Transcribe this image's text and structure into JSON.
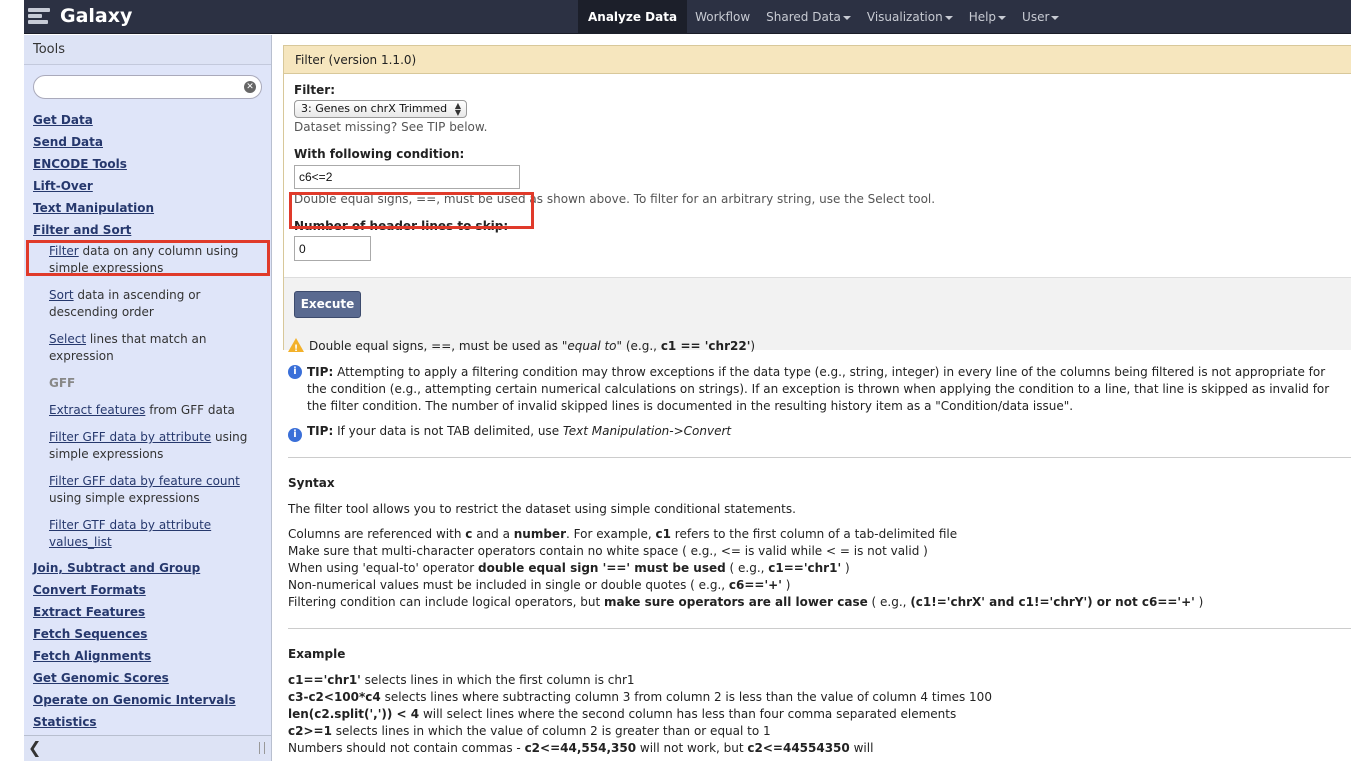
{
  "masthead": {
    "brand": "Galaxy",
    "nav": [
      {
        "label": "Analyze Data",
        "active": true,
        "dropdown": false
      },
      {
        "label": "Workflow",
        "active": false,
        "dropdown": false
      },
      {
        "label": "Shared Data",
        "active": false,
        "dropdown": true
      },
      {
        "label": "Visualization",
        "active": false,
        "dropdown": true
      },
      {
        "label": "Help",
        "active": false,
        "dropdown": true
      },
      {
        "label": "User",
        "active": false,
        "dropdown": true
      }
    ]
  },
  "tools": {
    "header": "Tools",
    "search_value": "",
    "sections_top": [
      "Get Data",
      "Send Data",
      "ENCODE Tools",
      "Lift-Over",
      "Text Manipulation",
      "Filter and Sort"
    ],
    "filter_tool": {
      "link": "Filter",
      "rest": " data on any column using simple expressions"
    },
    "sort_tool": {
      "link": "Sort",
      "rest": " data in ascending or descending order"
    },
    "select_tool": {
      "link": "Select",
      "rest": " lines that match an expression"
    },
    "gff_label": "GFF",
    "extract_tool": {
      "link": "Extract features",
      "rest": " from GFF data"
    },
    "gff_attr_tool": {
      "link": "Filter GFF data by attribute",
      "rest": " using simple expressions"
    },
    "gff_count_tool": {
      "link": "Filter GFF data by feature count",
      "rest": " using simple expressions"
    },
    "gtf_tool": {
      "link": "Filter GTF data by attribute values_list",
      "rest": ""
    },
    "sections_bottom": [
      "Join, Subtract and Group",
      "Convert Formats",
      "Extract Features",
      "Fetch Sequences",
      "Fetch Alignments",
      "Get Genomic Scores",
      "Operate on Genomic Intervals",
      "Statistics"
    ]
  },
  "form": {
    "title": "Filter (version 1.1.0)",
    "filter_label": "Filter:",
    "filter_value": "3: Genes on chrX Trimmed",
    "filter_help": "Dataset missing? See TIP below.",
    "condition_label": "With following condition:",
    "condition_value": "c6<=2",
    "condition_help": "Double equal signs, ==, must be used as shown above. To filter for an arbitrary string, use the Select tool.",
    "header_label": "Number of header lines to skip:",
    "header_value": "0",
    "execute_label": "Execute"
  },
  "help": {
    "warning_pre": "Double equal signs, ==, must be used as ",
    "warning_em": "\"equal to\"",
    "warning_mid": " (e.g., ",
    "warning_code": "c1 == 'chr22'",
    "warning_post": ")",
    "tip1_label": "TIP:",
    "tip1_text": " Attempting to apply a filtering condition may throw exceptions if the data type (e.g., string, integer) in every line of the columns being filtered is not appropriate for the condition (e.g., attempting certain numerical calculations on strings). If an exception is thrown when applying the condition to a line, that line is skipped as invalid for the filter condition. The number of invalid skipped lines is documented in the resulting history item as a \"Condition/data issue\".",
    "tip2_label": "TIP:",
    "tip2_text": " If your data is not TAB delimited, use ",
    "tip2_em": "Text Manipulation->Convert",
    "syntax_title": "Syntax",
    "syntax_intro": "The filter tool allows you to restrict the dataset using simple conditional statements.",
    "syntax_lines": [
      "Columns are referenced with <b>c</b> and a <b>number</b>. For example, <b>c1</b> refers to the first column of a tab-delimited file",
      "Make sure that multi-character operators contain no white space ( e.g., &lt;= is valid while &lt; = is not valid )",
      "When using 'equal-to' operator <b>double equal sign '==' must be used</b> ( e.g., <b>c1=='chr1'</b> )",
      "Non-numerical values must be included in single or double quotes ( e.g., <b>c6=='+'</b> )",
      "Filtering condition can include logical operators, but <b>make sure operators are all lower case</b> ( e.g., <b>(c1!='chrX' and c1!='chrY') or not c6=='+'</b> )"
    ],
    "example_title": "Example",
    "example_lines": [
      "<b>c1=='chr1'</b> selects lines in which the first column is chr1",
      "<b>c3-c2&lt;100*c4</b> selects lines where subtracting column 3 from column 2 is less than the value of column 4 times 100",
      "<b>len(c2.split(',')) &lt; 4</b> will select lines where the second column has less than four comma separated elements",
      "<b>c2&gt;=1</b> selects lines in which the value of column 2 is greater than or equal to 1",
      "Numbers should not contain commas - <b>c2&lt;=44,554,350</b> will not work, but <b>c2&lt;=44554350</b> will"
    ]
  }
}
